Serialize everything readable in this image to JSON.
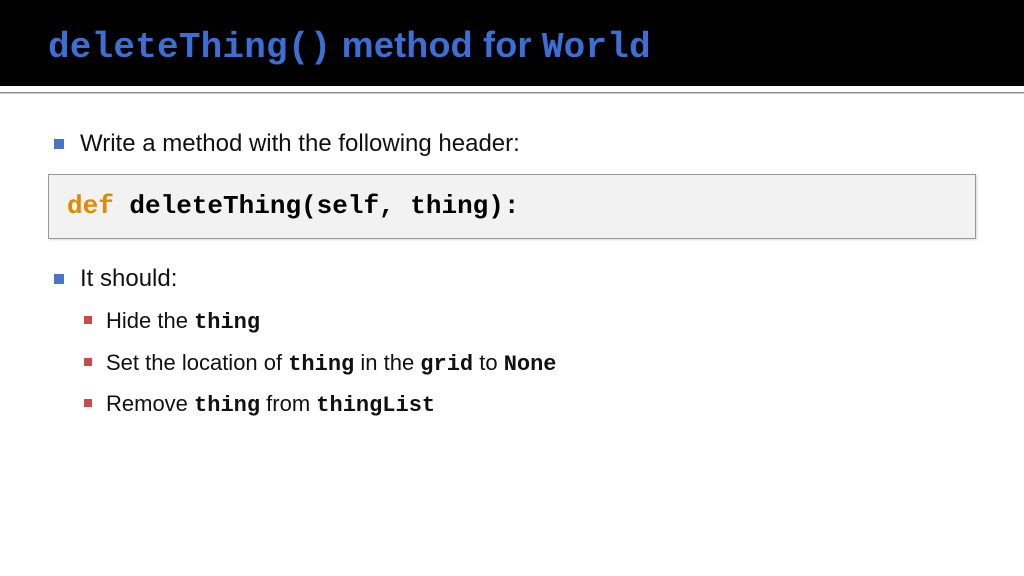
{
  "title": {
    "code1": "deleteThing()",
    "mid": " method for ",
    "code2": "World"
  },
  "bullets": {
    "b1": "Write a method with the following header:",
    "code": {
      "keyword": "def",
      "signature": " deleteThing(self, thing):"
    },
    "b2": "It should:",
    "sub": {
      "s1_pre": "Hide the ",
      "s1_code": "thing",
      "s2_pre": "Set the location of ",
      "s2_c1": "thing",
      "s2_mid": " in the ",
      "s2_c2": "grid",
      "s2_mid2": " to ",
      "s2_c3": "None",
      "s3_pre": "Remove ",
      "s3_c1": "thing",
      "s3_mid": " from ",
      "s3_c2": "thingList"
    }
  }
}
